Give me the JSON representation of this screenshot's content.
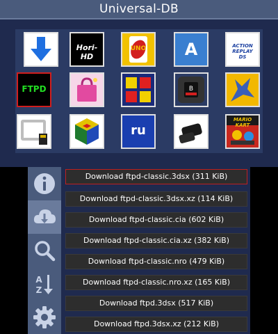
{
  "app": {
    "title": "Universal-DB"
  },
  "tiles": [
    {
      "name": "tile-download-arrow",
      "icon": "blue-download-arrow-icon"
    },
    {
      "name": "tile-hori-hd",
      "icon": "hori-hd-logo-icon",
      "text": "Hori-HD"
    },
    {
      "name": "tile-uno",
      "icon": "uno-card-icon",
      "text": "UNO"
    },
    {
      "name": "tile-appstore",
      "icon": "letter-a-icon",
      "text": "A"
    },
    {
      "name": "tile-action-replay",
      "icon": "action-replay-ds-logo-icon",
      "text": "ACTION REPLAY DS"
    },
    {
      "name": "tile-ftpd",
      "icon": "ftpd-icon",
      "text": "FTPD",
      "selected": true
    },
    {
      "name": "tile-shop-bag",
      "icon": "shopping-bag-icon"
    },
    {
      "name": "tile-four-squares",
      "icon": "four-colored-squares-icon"
    },
    {
      "name": "tile-console-badge",
      "icon": "console-badge-icon"
    },
    {
      "name": "tile-blue-creature",
      "icon": "blue-creature-icon"
    },
    {
      "name": "tile-window-sd",
      "icon": "window-sd-card-icon"
    },
    {
      "name": "tile-n64-cube",
      "icon": "n64-cube-icon"
    },
    {
      "name": "tile-ru",
      "icon": "ru-logo-icon",
      "text": "ru"
    },
    {
      "name": "tile-console-device",
      "icon": "game-console-device-icon"
    },
    {
      "name": "tile-mario-kart",
      "icon": "mario-kart-cover-icon",
      "text": "MARIO KART"
    }
  ],
  "sidebar": [
    {
      "name": "info-button",
      "icon": "info-icon",
      "active": false
    },
    {
      "name": "download-button",
      "icon": "cloud-download-icon",
      "active": true
    },
    {
      "name": "search-button",
      "icon": "search-icon",
      "active": false
    },
    {
      "name": "sort-button",
      "icon": "sort-az-icon",
      "active": false
    },
    {
      "name": "settings-button",
      "icon": "gear-icon",
      "active": false
    }
  ],
  "downloads": [
    {
      "label": "Download ftpd-classic.3dsx (311 KiB)",
      "selected": true
    },
    {
      "label": "Download ftpd-classic.3dsx.xz (114 KiB)",
      "selected": false
    },
    {
      "label": "Download ftpd-classic.cia (602 KiB)",
      "selected": false
    },
    {
      "label": "Download ftpd-classic.cia.xz (382 KiB)",
      "selected": false
    },
    {
      "label": "Download ftpd-classic.nro (479 KiB)",
      "selected": false
    },
    {
      "label": "Download ftpd-classic.nro.xz (165 KiB)",
      "selected": false
    },
    {
      "label": "Download ftpd.3dsx (517 KiB)",
      "selected": false
    },
    {
      "label": "Download ftpd.3dsx.xz (212 KiB)",
      "selected": false
    }
  ],
  "colors": {
    "background": "#1f2a4e",
    "bar": "#4a5b7c",
    "grid": "#2b3b64",
    "row": "#2d2d2d",
    "selection": "#d21e1e"
  }
}
